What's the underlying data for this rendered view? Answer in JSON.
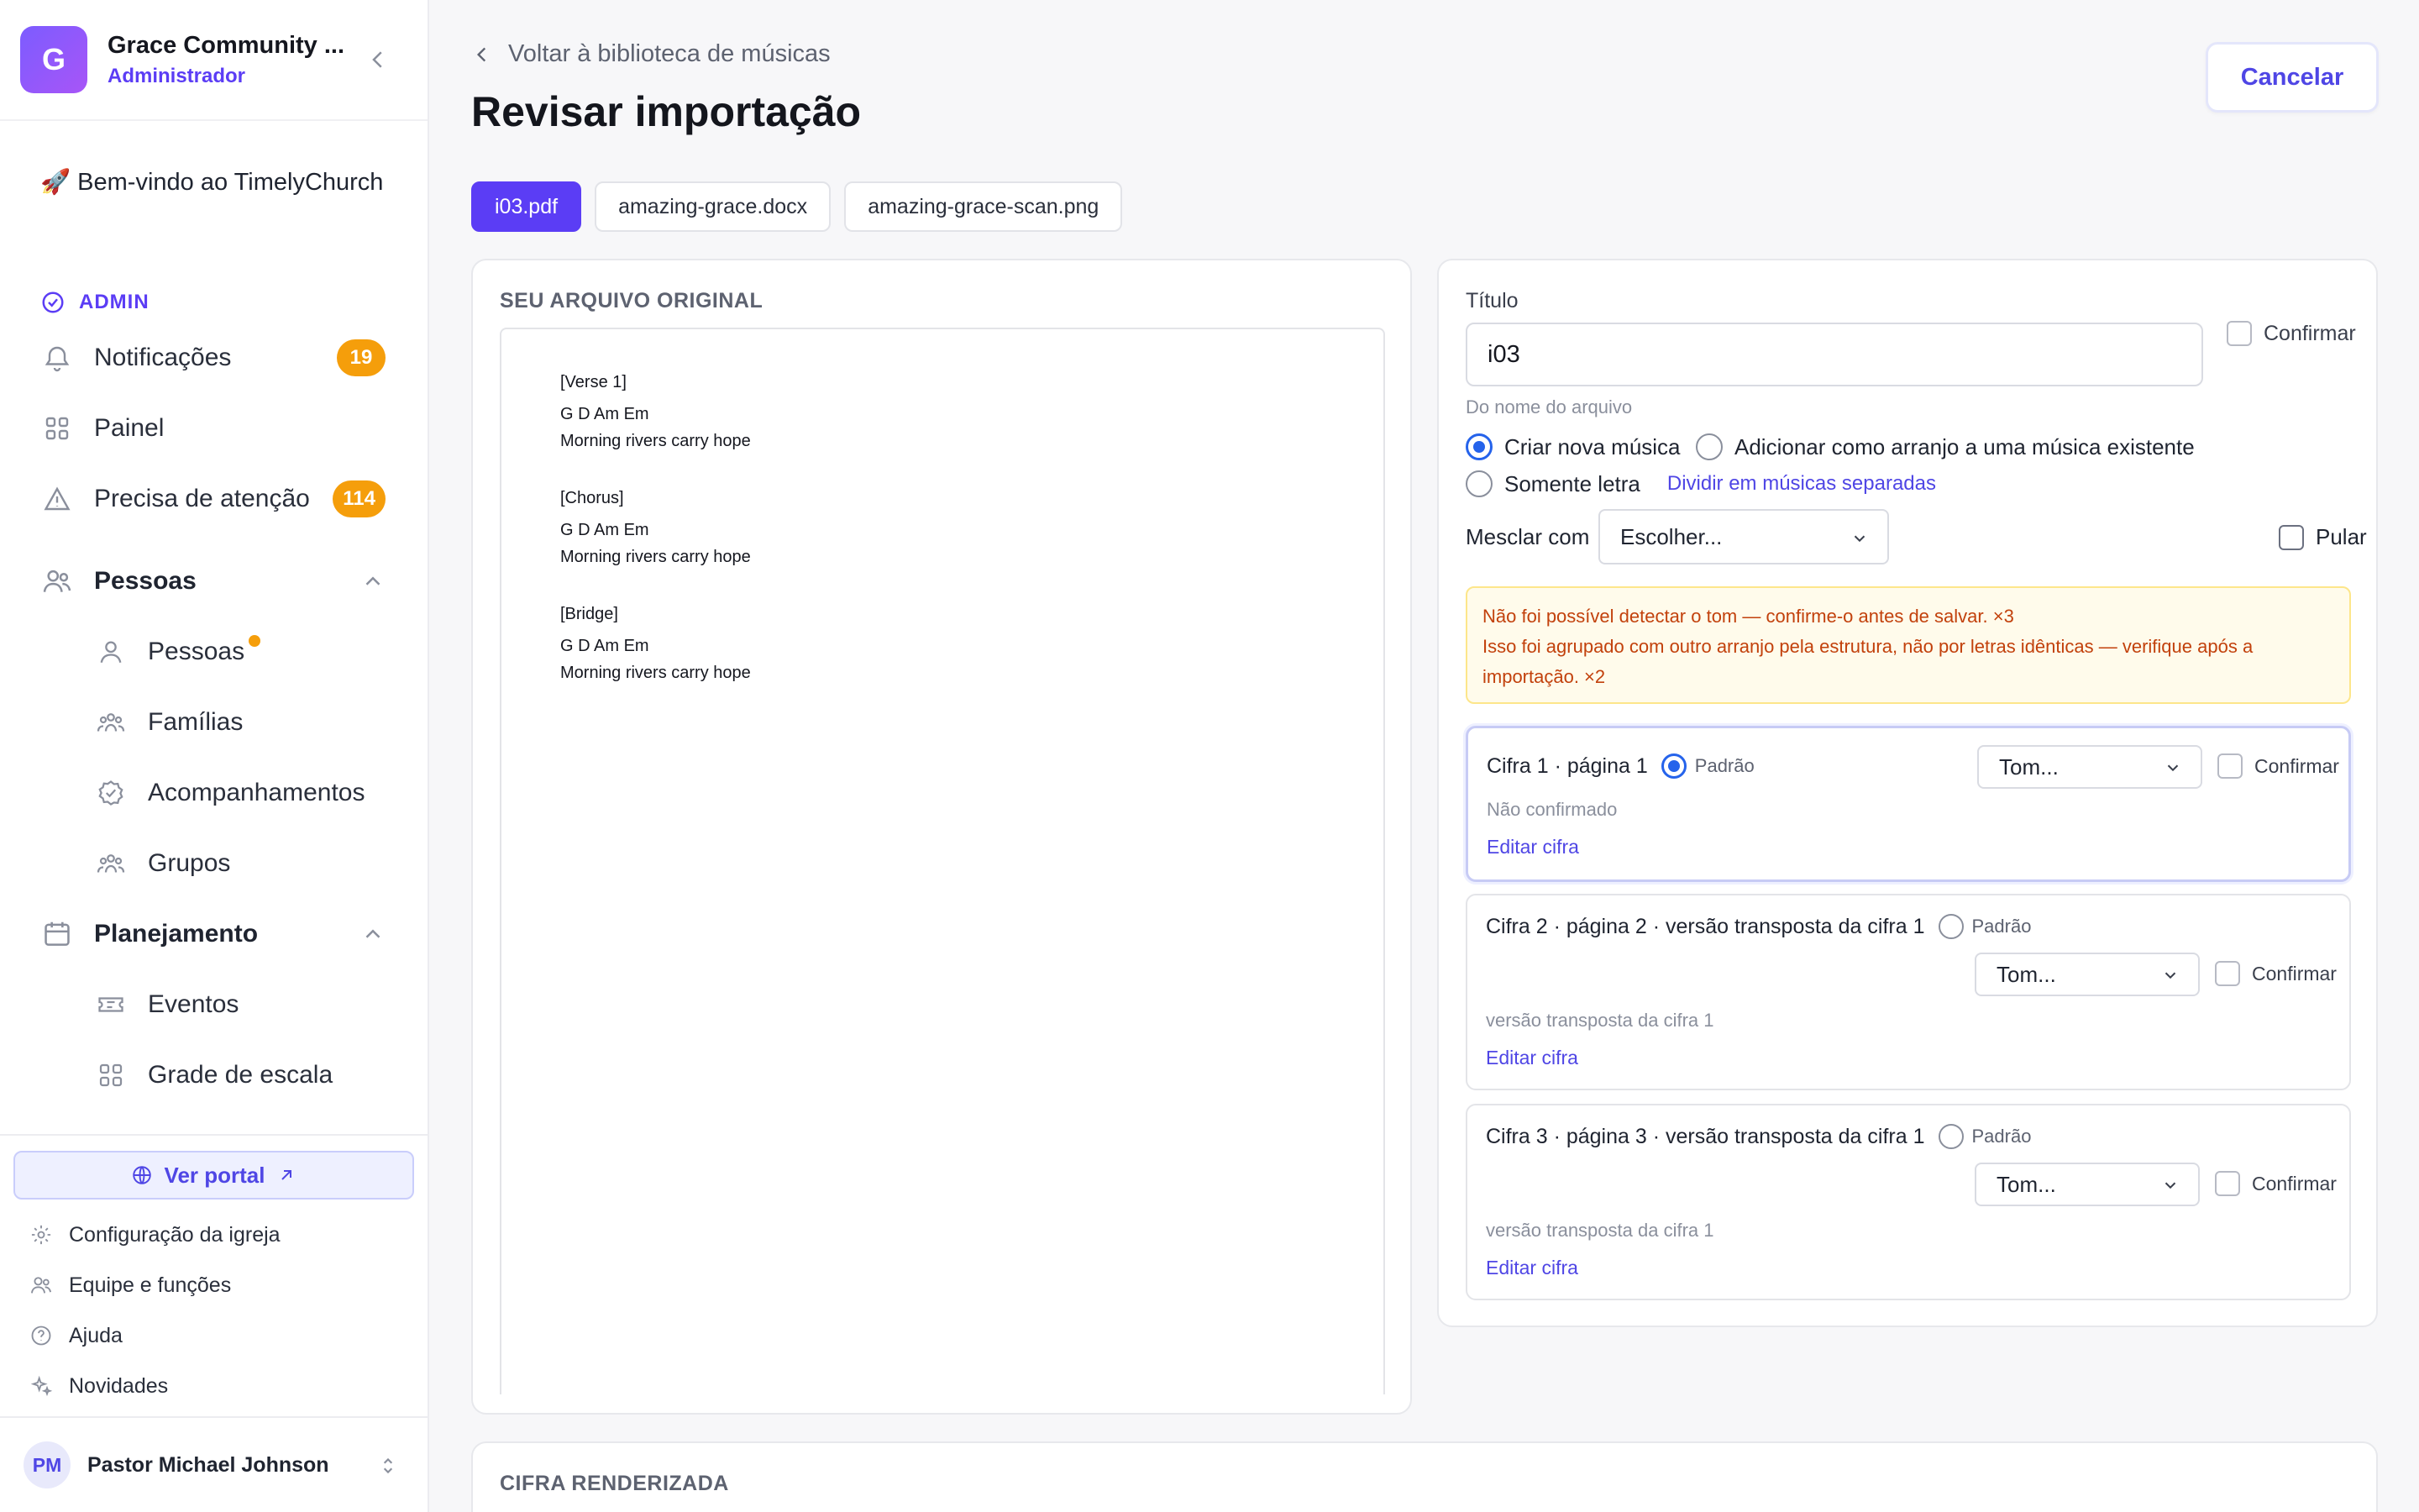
{
  "org": {
    "initial": "G",
    "name": "Grace Community ...",
    "role": "Administrador"
  },
  "sidebar": {
    "welcome_emoji": "🚀",
    "welcome": "Bem-vindo ao TimelyChurch",
    "section_admin": "ADMIN",
    "items": [
      {
        "label": "Notificações",
        "badge": "19"
      },
      {
        "label": "Painel"
      },
      {
        "label": "Precisa de atenção",
        "badge": "114"
      }
    ],
    "groups": [
      {
        "label": "Pessoas",
        "children": [
          "Pessoas",
          "Famílias",
          "Acompanhamentos",
          "Grupos"
        ]
      },
      {
        "label": "Planejamento",
        "children": [
          "Eventos",
          "Grade de escala"
        ]
      }
    ],
    "portal": "Ver portal",
    "footer": [
      "Configuração da igreja",
      "Equipe e funções",
      "Ajuda",
      "Novidades"
    ],
    "user": {
      "initials": "PM",
      "name": "Pastor Michael Johnson"
    }
  },
  "header": {
    "back": "Voltar à biblioteca de músicas",
    "title": "Revisar importação",
    "cancel": "Cancelar"
  },
  "files": [
    "i03.pdf",
    "amazing-grace.docx",
    "amazing-grace-scan.png"
  ],
  "original": {
    "label": "SEU ARQUIVO ORIGINAL",
    "lines": [
      "[Verse 1]",
      "G D Am Em",
      "Morning rivers carry hope",
      "[Chorus]",
      "G D Am Em",
      "Morning rivers carry hope",
      "[Bridge]",
      "G D Am Em",
      "Morning rivers carry hope"
    ]
  },
  "form": {
    "title_label": "Título",
    "title_value": "i03",
    "confirm": "Confirmar",
    "hint": "Do nome do arquivo",
    "opt_new": "Criar nova música",
    "opt_arrangement": "Adicionar como arranjo a uma música existente",
    "opt_lyrics": "Somente letra",
    "split_link": "Dividir em músicas separadas",
    "merge_label": "Mesclar com",
    "merge_placeholder": "Escolher...",
    "skip": "Pular",
    "warn1": "Não foi possível detectar o tom — confirme-o antes de salvar. ×3",
    "warn2": "Isso foi agrupado com outro arranjo pela estrutura, não por letras idênticas — verifique após a importação. ×2"
  },
  "cifras": [
    {
      "title": "Cifra 1 · página 1",
      "default": "Padrão",
      "key": "Tom...",
      "confirm": "Confirmar",
      "status": "Não confirmado",
      "edit": "Editar cifra"
    },
    {
      "title": "Cifra 2 · página 2 · versão transposta da cifra 1",
      "default": "Padrão",
      "key": "Tom...",
      "confirm": "Confirmar",
      "status": "versão transposta da cifra 1",
      "edit": "Editar cifra"
    },
    {
      "title": "Cifra 3 · página 3 · versão transposta da cifra 1",
      "default": "Padrão",
      "key": "Tom...",
      "confirm": "Confirmar",
      "status": "versão transposta da cifra 1",
      "edit": "Editar cifra"
    }
  ],
  "rendered": {
    "label": "CIFRA RENDERIZADA"
  },
  "colors": {
    "accent": "#5b3df5",
    "warning": "#f59e0b",
    "radio": "#2563eb"
  }
}
